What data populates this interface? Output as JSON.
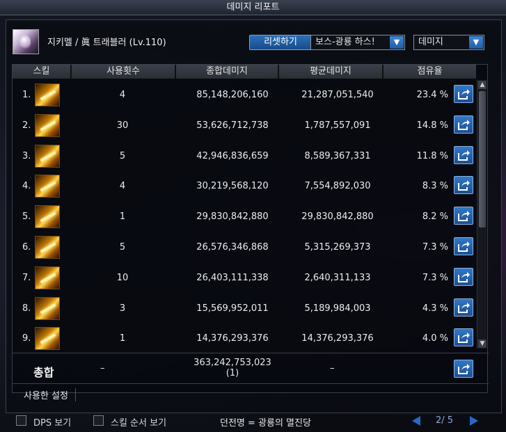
{
  "window": {
    "title": "데미지 리포트"
  },
  "header": {
    "character": "지키멜 / 眞 트래블러 (Lv.110)",
    "reset_label": "리셋하기",
    "dungeon_select": "보스-광룡 하스!",
    "metric_select": "데미지"
  },
  "columns": [
    "스킬",
    "사용횟수",
    "종합데미지",
    "평균데미지",
    "점유율"
  ],
  "rows": [
    {
      "no": "1.",
      "count": "4",
      "total": "85,148,206,160",
      "avg": "21,287,051,540",
      "share": "23.4 %"
    },
    {
      "no": "2.",
      "count": "30",
      "total": "53,626,712,738",
      "avg": "1,787,557,091",
      "share": "14.8 %"
    },
    {
      "no": "3.",
      "count": "5",
      "total": "42,946,836,659",
      "avg": "8,589,367,331",
      "share": "11.8 %"
    },
    {
      "no": "4.",
      "count": "4",
      "total": "30,219,568,120",
      "avg": "7,554,892,030",
      "share": "8.3 %"
    },
    {
      "no": "5.",
      "count": "1",
      "total": "29,830,842,880",
      "avg": "29,830,842,880",
      "share": "8.2 %"
    },
    {
      "no": "6.",
      "count": "5",
      "total": "26,576,346,868",
      "avg": "5,315,269,373",
      "share": "7.3 %"
    },
    {
      "no": "7.",
      "count": "10",
      "total": "26,403,111,338",
      "avg": "2,640,311,133",
      "share": "7.3 %"
    },
    {
      "no": "8.",
      "count": "3",
      "total": "15,569,952,011",
      "avg": "5,189,984,003",
      "share": "4.3 %"
    },
    {
      "no": "9.",
      "count": "1",
      "total": "14,376,293,376",
      "avg": "14,376,293,376",
      "share": "4.0 %"
    }
  ],
  "total": {
    "label": "총합",
    "count": "–",
    "value": "363,242,753,023",
    "sub": "(1)",
    "avg": "–"
  },
  "used_setting": "사용한 설정",
  "footer": {
    "dps_label": "DPS 보기",
    "order_label": "스킬 순서 보기",
    "dungeon": "던전명 = 광룡의 멸진당",
    "page": "2/ 5"
  }
}
